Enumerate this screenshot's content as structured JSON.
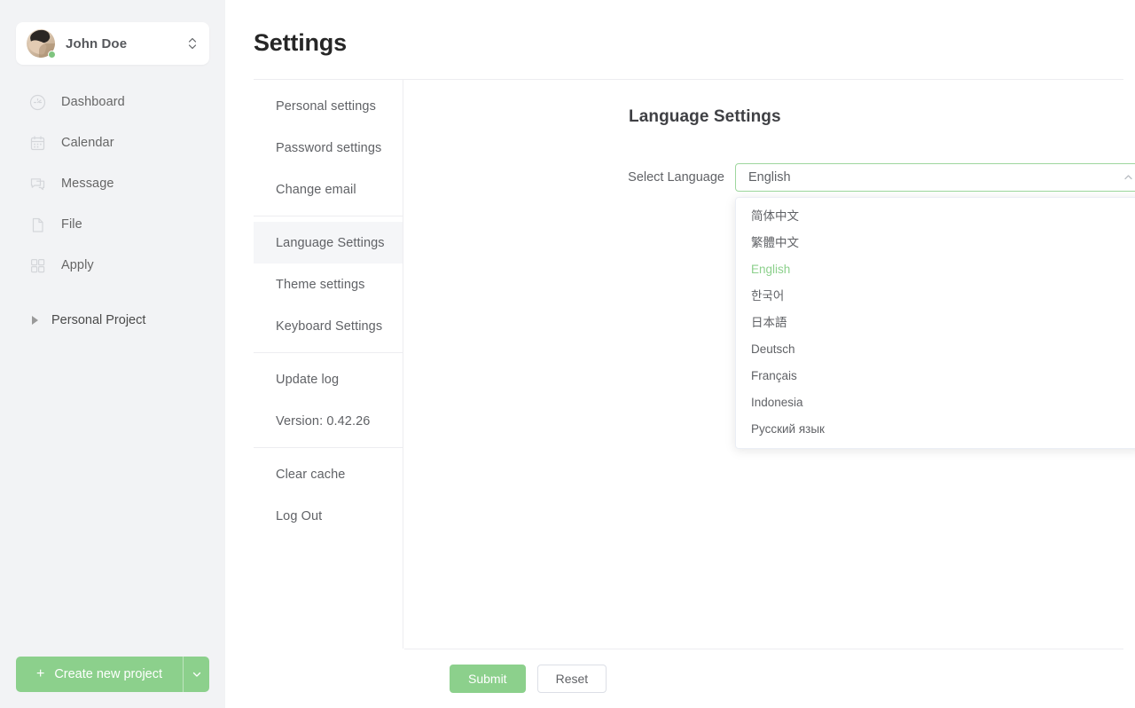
{
  "sidebar": {
    "user": {
      "name": "John Doe",
      "status": "online"
    },
    "nav_items": [
      {
        "label": "Dashboard",
        "icon": "dashboard-icon"
      },
      {
        "label": "Calendar",
        "icon": "calendar-icon"
      },
      {
        "label": "Message",
        "icon": "message-icon"
      },
      {
        "label": "File",
        "icon": "file-icon"
      },
      {
        "label": "Apply",
        "icon": "apply-grid-icon"
      }
    ],
    "project": {
      "label": "Personal Project"
    },
    "create_button": {
      "label": "Create new project",
      "plus": "+"
    }
  },
  "header": {
    "title": "Settings"
  },
  "settings_menu": {
    "groups": [
      {
        "items": [
          {
            "label": "Personal settings",
            "active": false
          },
          {
            "label": "Password settings",
            "active": false
          },
          {
            "label": "Change email",
            "active": false
          }
        ]
      },
      {
        "items": [
          {
            "label": "Language Settings",
            "active": true
          },
          {
            "label": "Theme settings",
            "active": false
          },
          {
            "label": "Keyboard Settings",
            "active": false
          }
        ]
      },
      {
        "items": [
          {
            "label": "Update log",
            "active": false
          },
          {
            "label": "Version: 0.42.26",
            "active": false,
            "static": true
          }
        ]
      },
      {
        "items": [
          {
            "label": "Clear cache",
            "active": false
          },
          {
            "label": "Log Out",
            "active": false
          }
        ]
      }
    ]
  },
  "panel": {
    "title": "Language Settings",
    "field_label": "Select Language",
    "select_value": "English",
    "select_placeholder": "Select Language",
    "dropdown_open": true,
    "options": [
      {
        "label": "简体中文",
        "selected": false
      },
      {
        "label": "繁體中文",
        "selected": false
      },
      {
        "label": "English",
        "selected": true
      },
      {
        "label": "한국어",
        "selected": false
      },
      {
        "label": "日本語",
        "selected": false
      },
      {
        "label": "Deutsch",
        "selected": false
      },
      {
        "label": "Français",
        "selected": false
      },
      {
        "label": "Indonesia",
        "selected": false
      },
      {
        "label": "Русский язык",
        "selected": false
      }
    ]
  },
  "footer": {
    "submit_label": "Submit",
    "reset_label": "Reset"
  },
  "colors": {
    "accent": "#8cd08c",
    "sidebar_bg": "#f2f3f5",
    "text": "#606266",
    "border": "#ededf0",
    "active_bg": "#f5f6f8"
  }
}
